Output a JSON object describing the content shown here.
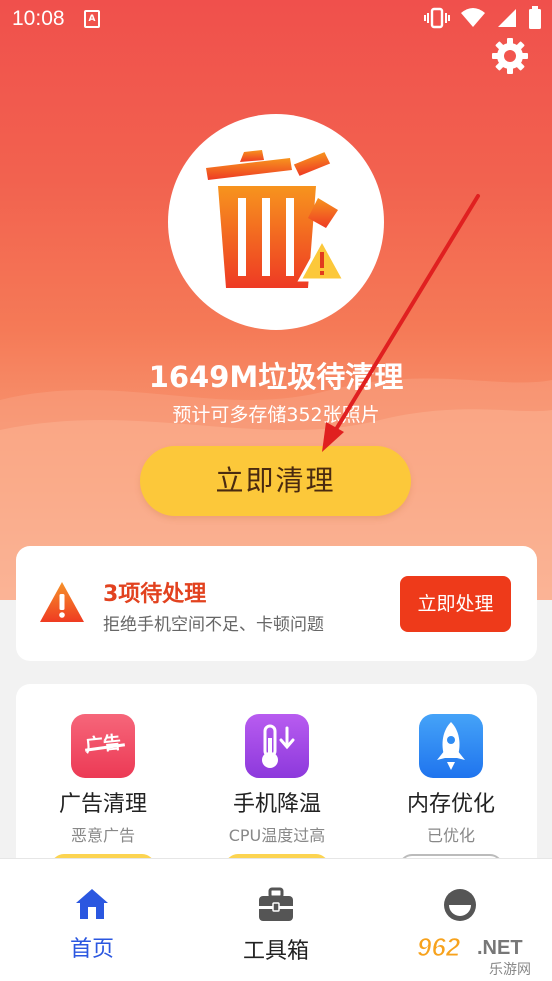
{
  "status_bar": {
    "time": "10:08",
    "notification_glyph": "A"
  },
  "hero": {
    "title": "1649M垃圾待清理",
    "subtitle": "预计可多存储352张照片",
    "clean_button": "立即清理"
  },
  "pending_card": {
    "title": "3项待处理",
    "description": "拒绝手机空间不足、卡顿问题",
    "button": "立即处理"
  },
  "tools": [
    {
      "label": "广告清理",
      "status": "恶意广告",
      "icon": "ad-clean-icon",
      "icon_text": "广告",
      "color": "#f0455a"
    },
    {
      "label": "手机降温",
      "status": "CPU温度过高",
      "icon": "thermometer-icon",
      "color": "#a24ae6"
    },
    {
      "label": "内存优化",
      "status": "已优化",
      "icon": "rocket-icon",
      "color": "#2f8cf3"
    }
  ],
  "bottom_nav": [
    {
      "label": "首页",
      "icon": "home-icon",
      "active": true
    },
    {
      "label": "工具箱",
      "icon": "toolbox-icon",
      "active": false
    },
    {
      "label": "",
      "icon": "profile-icon",
      "active": false
    }
  ],
  "watermark": {
    "logo": "962",
    "suffix": ".NET",
    "text": "乐游网"
  },
  "colors": {
    "accent": "#ee3a1a",
    "button_yellow": "#fcc83a",
    "nav_active": "#2b57e0"
  }
}
